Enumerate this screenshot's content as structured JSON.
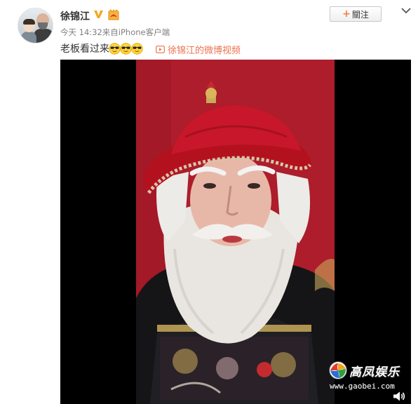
{
  "user": {
    "name": "徐锦江",
    "avatar_icon": "avatar-icon",
    "verified_icon": "verified-v-icon",
    "medal_icon": "member-medal-icon"
  },
  "post": {
    "meta": "今天 14:32来自iPhone客户端",
    "text": "老板看过来",
    "emoji_icon": "sunglasses-emoji-icon",
    "emoji_count": 3,
    "video_link": "徐锦江的微博视频"
  },
  "actions": {
    "follow_plus": "+",
    "follow_label": "關注",
    "menu_icon": "chevron-down-icon"
  },
  "watermark": {
    "title": "高凤娱乐",
    "url": "www.gaobei.com"
  },
  "colors": {
    "link": "#eb7350",
    "follow_plus": "#fa7d3c",
    "verified": "#f6a623",
    "video_bg": "#000000",
    "backdrop_red": "#b01e2c"
  }
}
